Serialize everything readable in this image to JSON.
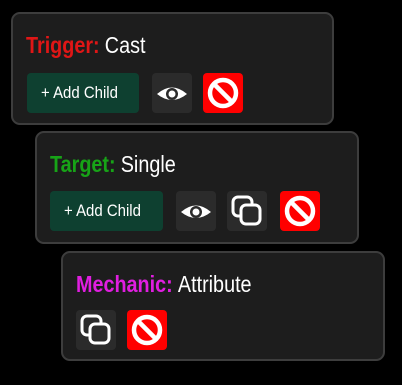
{
  "nodes": {
    "trigger": {
      "kind_label": "Trigger:",
      "value": "Cast",
      "kind_color": "#e01616",
      "add_child_label": "+ Add Child"
    },
    "target": {
      "kind_label": "Target:",
      "value": "Single",
      "kind_color": "#17a317",
      "add_child_label": "+ Add Child"
    },
    "mechanic": {
      "kind_label": "Mechanic:",
      "value": "Attribute",
      "kind_color": "#e01ee0"
    }
  },
  "colors": {
    "background": "#000000",
    "node_background": "#1d1d1d",
    "node_border": "#3d3d3d",
    "add_child_button": "#0e4030",
    "delete_button": "#ff0000",
    "icon_button": "#2b2b2b"
  },
  "icons": {
    "toggle_visibility": "eye-icon",
    "duplicate": "copy-icon",
    "delete": "no-entry-icon"
  }
}
